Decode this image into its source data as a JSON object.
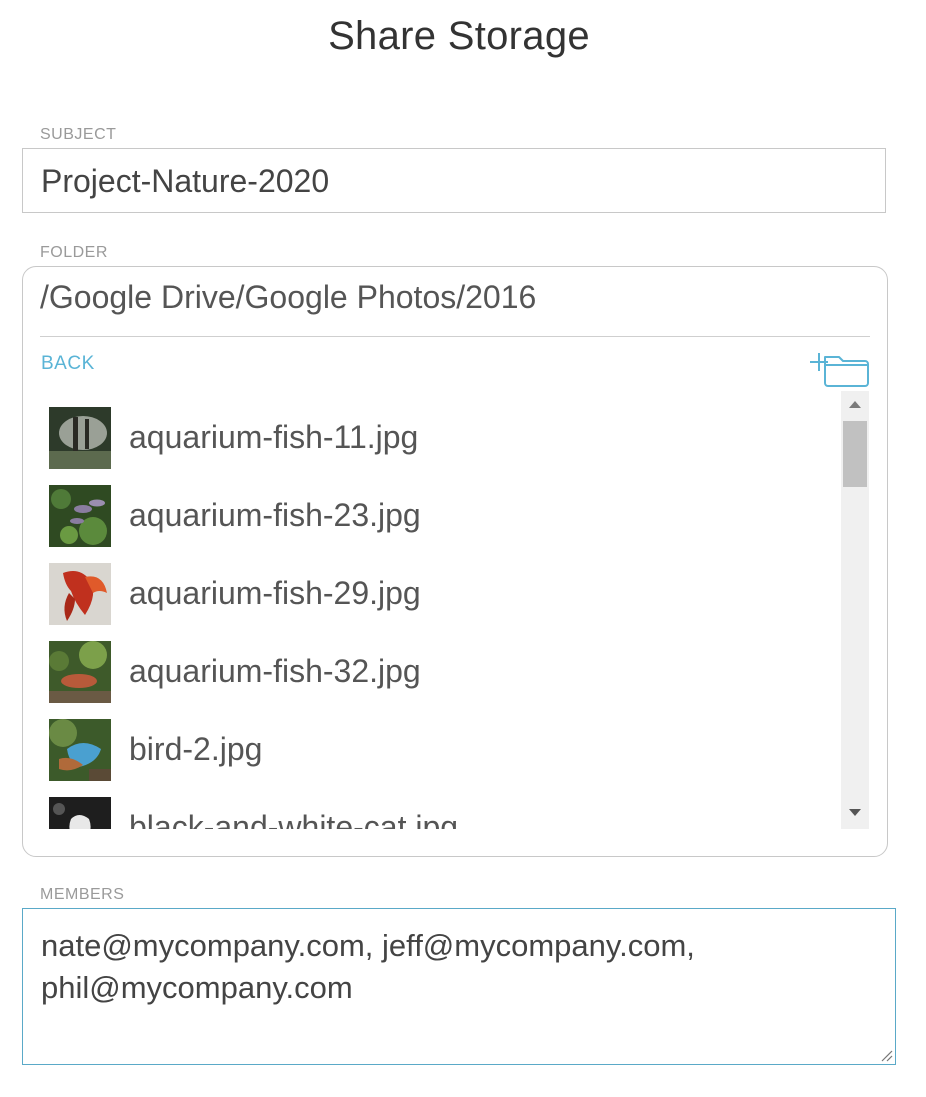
{
  "dialog": {
    "title": "Share Storage"
  },
  "subject": {
    "label": "SUBJECT",
    "value": "Project-Nature-2020"
  },
  "folder": {
    "label": "FOLDER",
    "path": "/Google Drive/Google Photos/2016",
    "back_label": "BACK",
    "new_folder_icon": "add-folder-icon",
    "files": [
      {
        "name": "aquarium-fish-11.jpg",
        "thumb_colors": [
          "#2d3a2a",
          "#9aa096",
          "#5c6a4e"
        ]
      },
      {
        "name": "aquarium-fish-23.jpg",
        "thumb_colors": [
          "#4f7a38",
          "#8a7da0",
          "#2f4a22"
        ]
      },
      {
        "name": "aquarium-fish-29.jpg",
        "thumb_colors": [
          "#d9d6d0",
          "#c0301e",
          "#e05a2a"
        ]
      },
      {
        "name": "aquarium-fish-32.jpg",
        "thumb_colors": [
          "#3e5a2a",
          "#b85a3a",
          "#7ca04a"
        ]
      },
      {
        "name": "bird-2.jpg",
        "thumb_colors": [
          "#3c5a2a",
          "#4aa0d0",
          "#b06a3a"
        ]
      },
      {
        "name": "black-and-white-cat.jpg",
        "thumb_colors": [
          "#1e1e1e",
          "#e8e8e8",
          "#555555"
        ]
      }
    ]
  },
  "members": {
    "label": "MEMBERS",
    "value": "nate@mycompany.com, jeff@mycompany.com, phil@mycompany.com"
  },
  "colors": {
    "accent": "#5ab4d6",
    "border": "#c8c8c8",
    "focus_border": "#5aa9c8"
  }
}
